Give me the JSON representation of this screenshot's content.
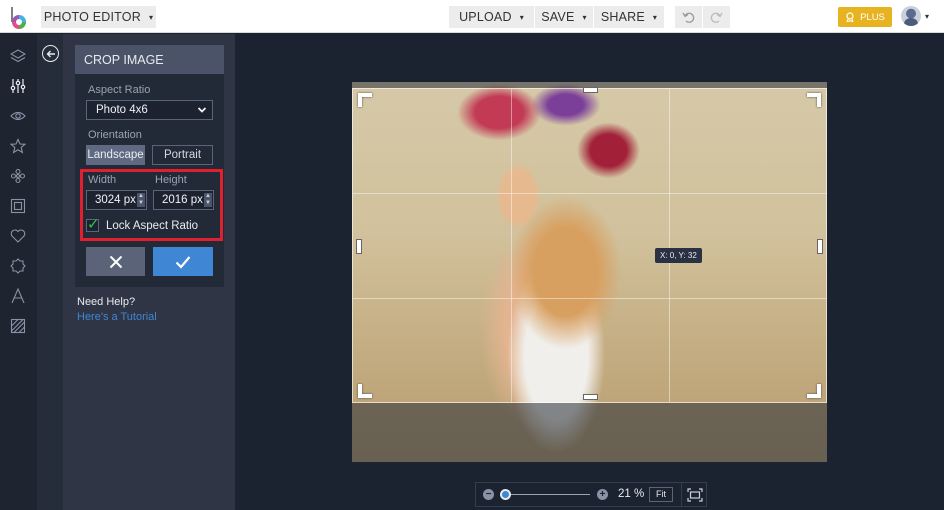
{
  "topbar": {
    "app_menu_label": "PHOTO EDITOR",
    "upload_label": "UPLOAD",
    "save_label": "SAVE",
    "share_label": "SHARE",
    "undo_icon": "undo-icon",
    "redo_icon": "redo-icon",
    "plus_label": "PLUS",
    "caret": "▾"
  },
  "rail": {
    "items": [
      {
        "name": "layers",
        "icon": "layers-icon"
      },
      {
        "name": "adjust",
        "icon": "sliders-icon",
        "active": true
      },
      {
        "name": "effects",
        "icon": "eye-icon"
      },
      {
        "name": "favorites",
        "icon": "star-icon"
      },
      {
        "name": "touch-up",
        "icon": "flower-icon"
      },
      {
        "name": "frames",
        "icon": "frame-icon"
      },
      {
        "name": "graphics",
        "icon": "heart-icon"
      },
      {
        "name": "overlays",
        "icon": "badge-icon"
      },
      {
        "name": "text",
        "icon": "text-icon"
      },
      {
        "name": "textures",
        "icon": "texture-icon"
      }
    ]
  },
  "panel": {
    "title": "CROP IMAGE",
    "aspect_ratio_label": "Aspect Ratio",
    "aspect_ratio_value": "Photo 4x6",
    "orientation_label": "Orientation",
    "orientation_options": [
      "Landscape",
      "Portrait"
    ],
    "orientation_selected": "Landscape",
    "width_label": "Width",
    "height_label": "Height",
    "width_value": "3024 px",
    "height_value": "2016 px",
    "lock_label": "Lock Aspect Ratio",
    "lock_checked": true,
    "cancel_glyph": "✕",
    "apply_glyph": "✓",
    "help_title": "Need Help?",
    "help_link": "Here's a Tutorial"
  },
  "canvas": {
    "coord_tooltip": "X: 0, Y: 32"
  },
  "zoom": {
    "value_label": "21 %",
    "level_fraction": 0.0,
    "fit_label": "Fit",
    "minus": "−",
    "plus": "+"
  }
}
